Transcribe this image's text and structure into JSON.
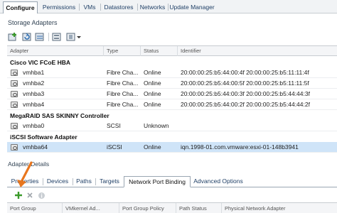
{
  "top_tabs": [
    "Configure",
    "Permissions",
    "VMs",
    "Datastores",
    "Networks",
    "Update Manager"
  ],
  "active_top_tab": "Configure",
  "storage_adapters": {
    "title": "Storage Adapters",
    "toolbar_icons": [
      "add-adapter-icon",
      "refresh-icon",
      "rescan-icon",
      "rescan-storage-icon",
      "actions-icon"
    ],
    "columns": [
      "Adapter",
      "Type",
      "Status",
      "Identifier"
    ],
    "groups": [
      {
        "name": "Cisco VIC FCoE HBA",
        "rows": [
          {
            "adapter": "vmhba1",
            "type": "Fibre Cha...",
            "status": "Online",
            "identifier": "20:00:00:25:b5:44:00:4f 20:00:00:25:b5:11:11:4f"
          },
          {
            "adapter": "vmhba2",
            "type": "Fibre Cha...",
            "status": "Online",
            "identifier": "20:00:00:25:b5:44:00:5f 20:00:00:25:b5:11:11:5f"
          },
          {
            "adapter": "vmhba3",
            "type": "Fibre Cha...",
            "status": "Online",
            "identifier": "20:00:00:25:b5:44:00:3f 20:00:00:25:b5:44:44:3f"
          },
          {
            "adapter": "vmhba4",
            "type": "Fibre Cha...",
            "status": "Online",
            "identifier": "20:00:00:25:b5:44:00:2f 20:00:00:25:b5:44:44:2f"
          }
        ]
      },
      {
        "name": "MegaRAID SAS SKINNY Controller",
        "rows": [
          {
            "adapter": "vmhba0",
            "type": "SCSI",
            "status": "Unknown",
            "identifier": ""
          }
        ]
      },
      {
        "name": "iSCSI Software Adapter",
        "rows": [
          {
            "adapter": "vmhba64",
            "type": "iSCSI",
            "status": "Online",
            "identifier": "iqn.1998-01.com.vmware:esxi-01-148b3941",
            "selected": true
          }
        ]
      }
    ]
  },
  "adapter_details": {
    "title": "Adapter Details",
    "tabs": [
      "Properties",
      "Devices",
      "Paths",
      "Targets",
      "Network Port Binding",
      "Advanced Options"
    ],
    "active_tab": "Network Port Binding",
    "toolbar_icons": [
      "add-icon",
      "remove-icon",
      "info-icon"
    ],
    "columns": [
      "Port Group",
      "VMkernel Ad...",
      "Port Group Policy",
      "Path Status",
      "Physical Network Adapter"
    ]
  },
  "colors": {
    "accent_selected_row": "#cfe4f8",
    "arrow": "#e8761e",
    "add_green": "#3a9a2a"
  }
}
